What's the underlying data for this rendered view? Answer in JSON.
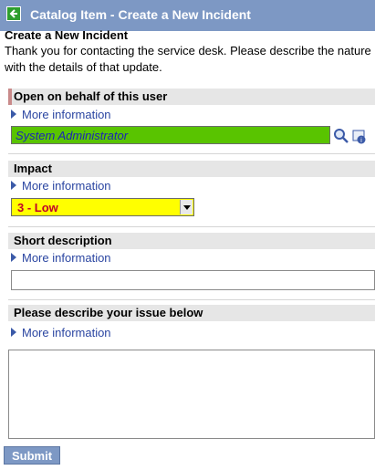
{
  "header": {
    "title": "Catalog Item - Create a New Incident",
    "back_icon": "back-arrow-icon",
    "color": "#7d98c4"
  },
  "intro": {
    "title": "Create a New Incident",
    "line1": "Thank you for contacting the service desk. Please describe the nature",
    "line2": "with the details of that update."
  },
  "sections": {
    "behalf": {
      "label": "Open on behalf of this user",
      "more_info": "More information",
      "value": "System Administrator",
      "mandatory": true
    },
    "impact": {
      "label": "Impact",
      "more_info": "More information",
      "selected": "3 - Low"
    },
    "short_description": {
      "label": "Short description",
      "more_info": "More information",
      "value": ""
    },
    "issue": {
      "label": "Please describe your issue below",
      "more_info": "More information",
      "value": ""
    }
  },
  "submit": {
    "label": "Submit"
  },
  "colors": {
    "header_bg": "#7d98c4",
    "reference_field_bg": "#59c400",
    "impact_field_bg": "#ffff00",
    "link": "#2a45a1"
  }
}
